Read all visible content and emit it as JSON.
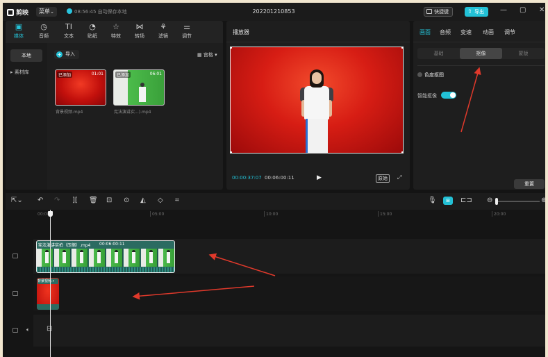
{
  "app": {
    "logo_text": "剪映",
    "menu_label": "菜单",
    "save_status": "08:56:45 自动保存本地",
    "project_title": "202201210853",
    "shortcut_label": "快捷键",
    "export_label": "导出",
    "window_controls": [
      "—",
      "▢",
      "✕"
    ]
  },
  "tool_tabs": [
    {
      "icon": "media-icon",
      "label": "媒体",
      "active": true
    },
    {
      "icon": "audio-icon",
      "label": "音频"
    },
    {
      "icon": "text-icon",
      "label": "文本"
    },
    {
      "icon": "sticker-icon",
      "label": "贴纸"
    },
    {
      "icon": "effects-icon",
      "label": "特效"
    },
    {
      "icon": "transition-icon",
      "label": "转场"
    },
    {
      "icon": "filter-icon",
      "label": "滤镜"
    },
    {
      "icon": "adjust-icon",
      "label": "调节"
    }
  ],
  "media": {
    "sidebar_local": "本地",
    "sidebar_library": "素材库",
    "import_label": "导入",
    "view_label": "宫格",
    "items": [
      {
        "name": "背景视频.mp4",
        "badge": "已添加",
        "duration": "01:01"
      },
      {
        "name": "宪法演讲实...).mp4",
        "badge": "已添加",
        "duration": "06:01"
      }
    ]
  },
  "player": {
    "title": "播放器",
    "current_time": "00:00:37:07",
    "total_time": "00:06:00:11",
    "original_label": "原始"
  },
  "props": {
    "tabs": [
      "画面",
      "音频",
      "变速",
      "动画",
      "调节"
    ],
    "active_tab": "画面",
    "segments": [
      "基础",
      "抠像",
      "蒙版"
    ],
    "active_segment": "抠像",
    "chroma_label": "色度抠图",
    "smart_label": "智能抠像",
    "smart_enabled": true,
    "reset_label": "重置"
  },
  "timeline": {
    "ruler": [
      "00:00",
      "05:00",
      "10:00",
      "15:00",
      "20:00"
    ],
    "main_clip_title": "宪法演讲实拍（压缩）.mp4",
    "main_clip_duration": "00:06:00:11",
    "bg_clip_title": "背景视频.r"
  },
  "colors": {
    "accent": "#22c1d6",
    "background": "#141414",
    "clip_teal": "#2b6b61",
    "annotation_arrow": "#e0392b"
  }
}
